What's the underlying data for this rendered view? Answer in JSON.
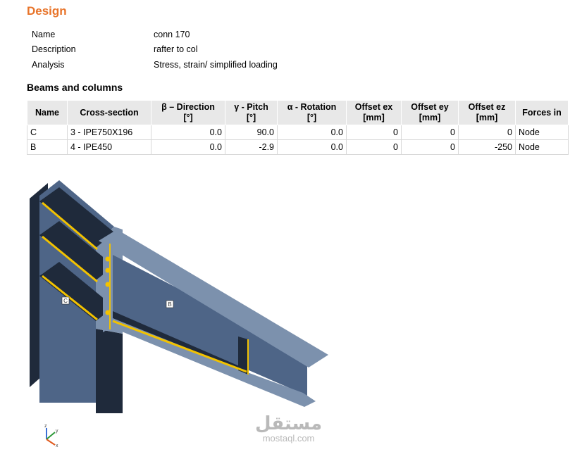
{
  "design": {
    "title": "Design",
    "properties": [
      {
        "key": "Name",
        "value": "conn 170"
      },
      {
        "key": "Description",
        "value": "rafter to col"
      },
      {
        "key": "Analysis",
        "value": "Stress, strain/ simplified loading"
      }
    ]
  },
  "beams": {
    "title": "Beams and columns",
    "headers": [
      {
        "line1": "Name",
        "line2": ""
      },
      {
        "line1": "Cross-section",
        "line2": ""
      },
      {
        "line1": "β – Direction",
        "line2": "[°]"
      },
      {
        "line1": "γ - Pitch",
        "line2": "[°]"
      },
      {
        "line1": "α - Rotation",
        "line2": "[°]"
      },
      {
        "line1": "Offset ex",
        "line2": "[mm]"
      },
      {
        "line1": "Offset ey",
        "line2": "[mm]"
      },
      {
        "line1": "Offset ez",
        "line2": "[mm]"
      },
      {
        "line1": "Forces in",
        "line2": ""
      }
    ],
    "rows": [
      {
        "name": "C",
        "section": "3 - IPE750X196",
        "direction": "0.0",
        "pitch": "90.0",
        "rotation": "0.0",
        "ex": "0",
        "ey": "0",
        "ez": "0",
        "forces": "Node"
      },
      {
        "name": "B",
        "section": "4 - IPE450",
        "direction": "0.0",
        "pitch": "-2.9",
        "rotation": "0.0",
        "ex": "0",
        "ey": "0",
        "ez": "-250",
        "forces": "Node"
      }
    ]
  },
  "model": {
    "member_labels": {
      "column": "C",
      "beam": "B"
    },
    "colors": {
      "steel": "#4e6587",
      "steel_light": "#7c91ad",
      "dark": "#1f2a3b",
      "weld": "#f2c200"
    },
    "axis_labels": {
      "z": "z",
      "y": "y",
      "x": "x"
    }
  },
  "watermark": {
    "arabic": "مستقل",
    "domain": "mostaql.com"
  }
}
